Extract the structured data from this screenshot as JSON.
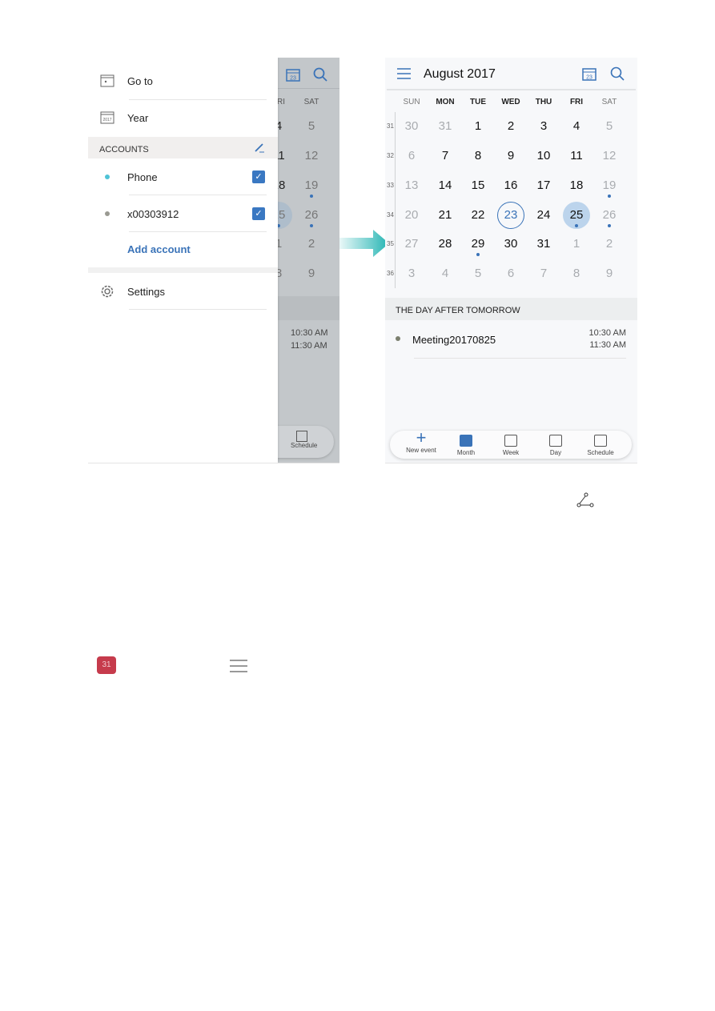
{
  "drawer": {
    "goto": "Go to",
    "year": "Year",
    "year_icon_text": "2017",
    "accounts_header": "ACCOUNTS",
    "accounts": [
      {
        "name": "Phone",
        "color": "#4fc3d6",
        "checked": true
      },
      {
        "name": "x00303912",
        "color": "#9a9a92",
        "checked": true
      }
    ],
    "add_account": "Add account",
    "settings": "Settings"
  },
  "dimmed": {
    "headers": [
      "FRI",
      "SAT"
    ],
    "rows": [
      [
        "4",
        "5"
      ],
      [
        "11",
        "12"
      ],
      [
        "18",
        "19"
      ],
      [
        "25",
        "26"
      ],
      [
        "1",
        "2"
      ],
      [
        "8",
        "9"
      ]
    ],
    "times": [
      "10:30 AM",
      "11:30 AM"
    ],
    "tab": "Schedule"
  },
  "calendar": {
    "title": "August 2017",
    "today_icon": "23",
    "accent": "#3a73b8",
    "weekdays": [
      "SUN",
      "MON",
      "TUE",
      "WED",
      "THU",
      "FRI",
      "SAT"
    ],
    "weeks": [
      {
        "n": "31",
        "days": [
          [
            "30",
            "m"
          ],
          [
            "31",
            "m"
          ],
          [
            "1",
            ""
          ],
          [
            "2",
            ""
          ],
          [
            "3",
            ""
          ],
          [
            "4",
            ""
          ],
          [
            "5",
            "m"
          ]
        ]
      },
      {
        "n": "32",
        "days": [
          [
            "6",
            "m"
          ],
          [
            "7",
            ""
          ],
          [
            "8",
            ""
          ],
          [
            "9",
            ""
          ],
          [
            "10",
            ""
          ],
          [
            "11",
            ""
          ],
          [
            "12",
            "m"
          ]
        ]
      },
      {
        "n": "33",
        "days": [
          [
            "13",
            "m"
          ],
          [
            "14",
            ""
          ],
          [
            "15",
            ""
          ],
          [
            "16",
            ""
          ],
          [
            "17",
            ""
          ],
          [
            "18",
            ""
          ],
          [
            "19",
            "m ev"
          ]
        ]
      },
      {
        "n": "34",
        "days": [
          [
            "20",
            "m"
          ],
          [
            "21",
            ""
          ],
          [
            "22",
            ""
          ],
          [
            "23",
            "today"
          ],
          [
            "24",
            ""
          ],
          [
            "25",
            "sel ev"
          ],
          [
            "26",
            "m ev"
          ]
        ]
      },
      {
        "n": "35",
        "days": [
          [
            "27",
            "m"
          ],
          [
            "28",
            ""
          ],
          [
            "29",
            "ev"
          ],
          [
            "30",
            ""
          ],
          [
            "31",
            ""
          ],
          [
            "1",
            "m"
          ],
          [
            "2",
            "m"
          ]
        ]
      },
      {
        "n": "36",
        "days": [
          [
            "3",
            "m"
          ],
          [
            "4",
            "m"
          ],
          [
            "5",
            "m"
          ],
          [
            "6",
            "m"
          ],
          [
            "7",
            "m"
          ],
          [
            "8",
            "m"
          ],
          [
            "9",
            "m"
          ]
        ]
      }
    ]
  },
  "agenda": {
    "header": "THE DAY AFTER TOMORROW",
    "event": {
      "title": "Meeting20170825",
      "start": "10:30 AM",
      "end": "11:30 AM",
      "color": "#7b7f6e"
    }
  },
  "tabs": [
    {
      "label": "New event",
      "icon": "plus-icon"
    },
    {
      "label": "Month",
      "icon": "month-icon",
      "active": true
    },
    {
      "label": "Week",
      "icon": "week-icon"
    },
    {
      "label": "Day",
      "icon": "day-icon"
    },
    {
      "label": "Schedule",
      "icon": "schedule-icon"
    }
  ],
  "calendar_app_icon": "31"
}
